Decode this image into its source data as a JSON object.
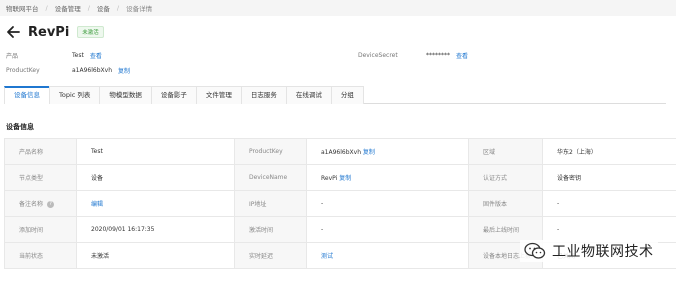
{
  "breadcrumb": [
    "物联网平台",
    "设备管理",
    "设备",
    "设备详情"
  ],
  "title": "RevPi",
  "status": "未激活",
  "meta": {
    "product_label": "产品",
    "product_value": "Test",
    "product_link": "查看",
    "productkey_label": "ProductKey",
    "productkey_value": "a1A96l6bXvh",
    "productkey_link": "复制",
    "secret_label": "DeviceSecret",
    "secret_value": "********",
    "secret_link": "查看"
  },
  "tabs": [
    "设备信息",
    "Topic 列表",
    "物模型数据",
    "设备影子",
    "文件管理",
    "日志服务",
    "在线调试",
    "分组"
  ],
  "active_tab": "设备信息",
  "section_title": "设备信息",
  "rows": [
    {
      "k1": "产品名称",
      "v1": "Test",
      "k2": "ProductKey",
      "v2": "a1A96l6bXvh",
      "v2_link": "复制",
      "k3": "区域",
      "v3": "华东2（上海）"
    },
    {
      "k1": "节点类型",
      "v1": "设备",
      "k2": "DeviceName",
      "v2": "RevPi",
      "v2_link": "复制",
      "k3": "认证方式",
      "v3": "设备密钥"
    },
    {
      "k1": "备注名称",
      "v1": "编辑",
      "k2": "IP地址",
      "v2": "-",
      "k3": "固件版本",
      "v3": "-"
    },
    {
      "k1": "添加时间",
      "v1": "2020/09/01 16:17:35",
      "k2": "激活时间",
      "v2": "-",
      "k3": "最后上线时间",
      "v3": "-"
    },
    {
      "k1": "当前状态",
      "v1": "未激活",
      "k2": "实时延迟",
      "v2": "测试",
      "k3": "设备本地日志上报",
      "v3": "已关闭"
    }
  ],
  "watermark": "工业物联网技术",
  "colors": {
    "link": "#1f77d0",
    "status_green": "#3a9a3a",
    "tab_active": "#1f77d0"
  }
}
